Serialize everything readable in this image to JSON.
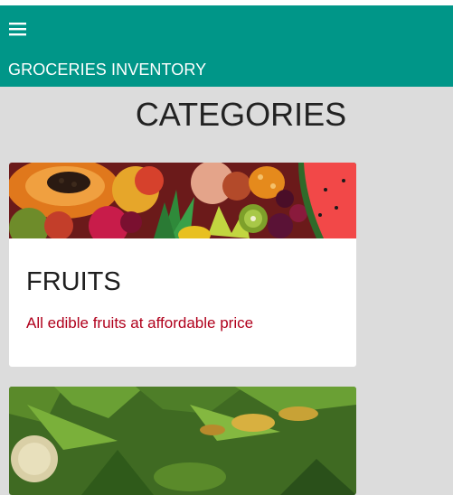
{
  "header": {
    "title": "GROCERIES INVENTORY",
    "menu_icon": "hamburger-menu-icon"
  },
  "page": {
    "heading": "CATEGORIES"
  },
  "categories": [
    {
      "title": "FRUITS",
      "description": "All edible fruits at affordable price",
      "image": "assorted-fruits-photo"
    },
    {
      "title": "",
      "description": "",
      "image": "leafy-vegetables-photo"
    }
  ],
  "colors": {
    "header_bg": "#009688",
    "page_bg": "#dcdcdc",
    "description_text": "#b0001c"
  }
}
